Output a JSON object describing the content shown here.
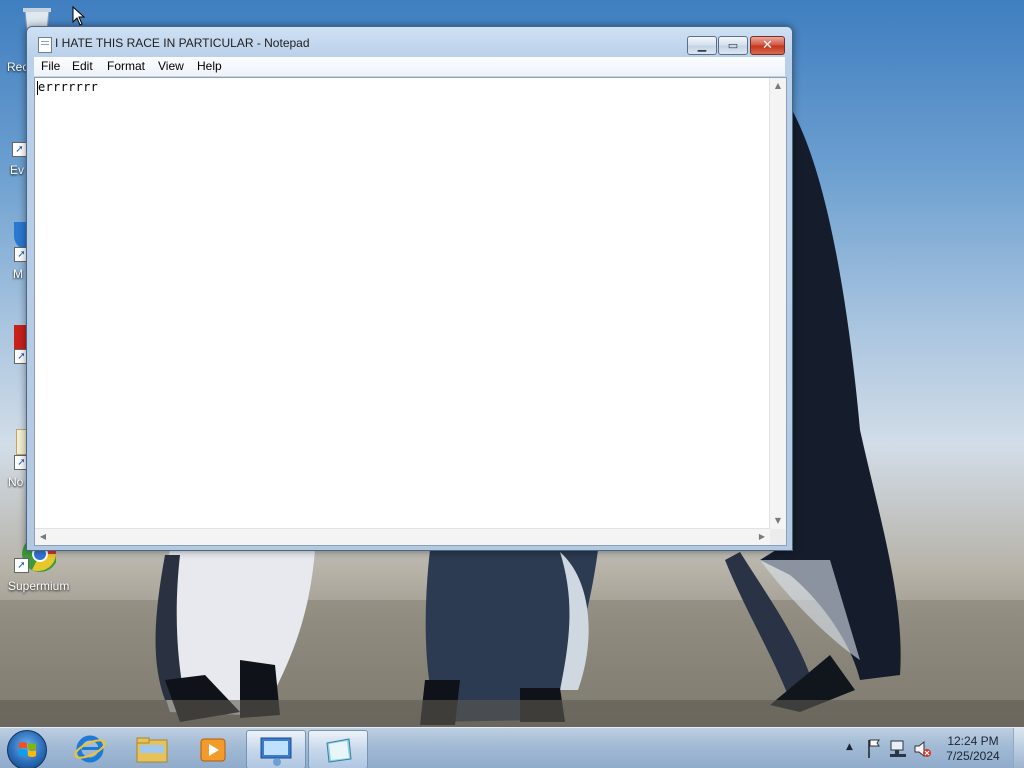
{
  "desktop": {
    "icons": [
      {
        "label": "Rec",
        "icon": "recycle-bin-icon"
      },
      {
        "label": "Ev",
        "icon": "shortcut-icon"
      },
      {
        "label": "M",
        "icon": "shortcut-icon"
      },
      {
        "label": "",
        "icon": "shortcut-icon"
      },
      {
        "label": "No",
        "icon": "shortcut-icon"
      },
      {
        "label": "Supermium",
        "icon": "supermium-icon"
      }
    ]
  },
  "notepad": {
    "title": "I HATE THIS RACE IN PARTICULAR - Notepad",
    "menu": [
      "File",
      "Edit",
      "Format",
      "View",
      "Help"
    ],
    "content": "errrrrrr",
    "buttons": {
      "minimize": "minimize-icon",
      "maximize": "maximize-icon",
      "close": "close-icon"
    }
  },
  "taskbar": {
    "start_icon": "windows-start-icon",
    "pinned": [
      {
        "name": "internet-explorer-icon",
        "active": false
      },
      {
        "name": "file-explorer-icon",
        "active": false
      },
      {
        "name": "media-player-icon",
        "active": false
      },
      {
        "name": "remote-desktop-icon",
        "active": true
      },
      {
        "name": "notepad-icon",
        "active": true
      }
    ],
    "tray_icons": [
      "show-hidden-icons-chevron",
      "action-center-flag-icon",
      "network-icon",
      "volume-muted-icon"
    ],
    "clock": {
      "time": "12:24 PM",
      "date": "7/25/2024"
    }
  }
}
